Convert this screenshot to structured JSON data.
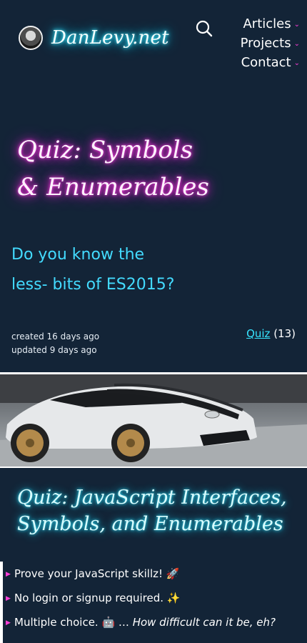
{
  "header": {
    "brand": "DanLevy.net",
    "nav": [
      {
        "label": "Articles"
      },
      {
        "label": "Projects"
      },
      {
        "label": "Contact"
      }
    ]
  },
  "hero": {
    "title_line1": "Quiz: Symbols",
    "title_line2": "& Enumerables",
    "subtitle_line1": "Do you know the",
    "subtitle_line2": "less- bits of ES2015?"
  },
  "meta": {
    "created": "created 16 days ago",
    "updated": "updated 9 days ago",
    "tag_label": "Quiz",
    "tag_count": "(13)"
  },
  "section": {
    "title_line1": "Quiz: JavaScript Interfaces,",
    "title_line2": "Symbols, and Enumerables"
  },
  "bullets": [
    {
      "text": "Prove your JavaScript skillz! 🚀",
      "extra": ""
    },
    {
      "text": "No login or signup required. ✨",
      "extra": ""
    },
    {
      "text": "Multiple choice. 🤖 … ",
      "extra": "How difficult can it be, eh?"
    }
  ],
  "colors": {
    "background": "#132437",
    "accent_cyan": "#43dbff",
    "accent_magenta": "#ff3fd7"
  },
  "icons": {
    "search": "search-icon",
    "chevron": "chevron-down-icon",
    "bullet": "triangle-bullet-icon"
  }
}
